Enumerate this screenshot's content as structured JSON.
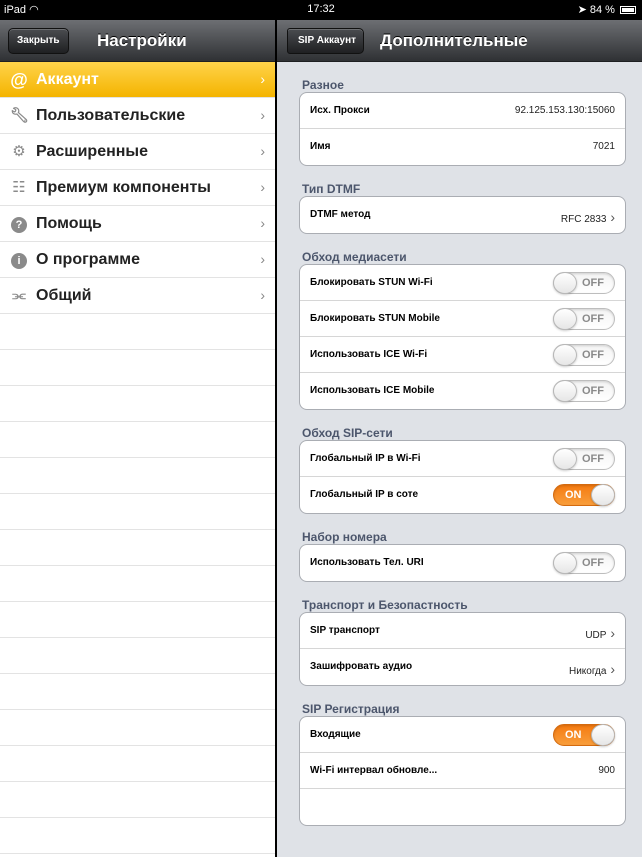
{
  "statusbar": {
    "device": "iPad",
    "time": "17:32",
    "battery": "84 %"
  },
  "left": {
    "close_label": "Закрыть",
    "title": "Настройки",
    "menu": [
      {
        "label": "Аккаунт",
        "icon": "at-icon",
        "active": true
      },
      {
        "label": "Пользовательские",
        "icon": "wrench-icon"
      },
      {
        "label": "Расширенные",
        "icon": "gears-icon"
      },
      {
        "label": "Премиум компоненты",
        "icon": "cart-icon"
      },
      {
        "label": "Помощь",
        "icon": "help-icon"
      },
      {
        "label": "О программе",
        "icon": "info-icon"
      },
      {
        "label": "Общий",
        "icon": "connector-icon"
      }
    ]
  },
  "right": {
    "back_label": "SIP Аккаунт",
    "title": "Дополнительные",
    "sections": {
      "misc": {
        "header": "Разное",
        "outbound_proxy": {
          "label": "Исх. Прокси",
          "value": "92.125.153.130:15060"
        },
        "name": {
          "label": "Имя",
          "value": "7021"
        }
      },
      "dtmf": {
        "header": "Тип DTMF",
        "method": {
          "label": "DTMF метод",
          "value": "RFC 2833"
        }
      },
      "media_nat": {
        "header": "Обход медиасети",
        "stun_wifi": {
          "label": "Блокировать STUN Wi-Fi",
          "state": "OFF"
        },
        "stun_mobile": {
          "label": "Блокировать STUN Mobile",
          "state": "OFF"
        },
        "ice_wifi": {
          "label": "Использовать ICE Wi-Fi",
          "state": "OFF"
        },
        "ice_mobile": {
          "label": "Использовать ICE Mobile",
          "state": "OFF"
        }
      },
      "sip_nat": {
        "header": "Обход SIP-сети",
        "global_ip_wifi": {
          "label": "Глобальный IP в Wi-Fi",
          "state": "OFF"
        },
        "global_ip_cell": {
          "label": "Глобальный IP в соте",
          "state": "ON"
        }
      },
      "dialing": {
        "header": "Набор номера",
        "tel_uri": {
          "label": "Использовать Тел. URI",
          "state": "OFF"
        }
      },
      "transport": {
        "header": "Транспорт и Безопастность",
        "sip_transport": {
          "label": "SIP транспорт",
          "value": "UDP"
        },
        "encrypt_audio": {
          "label": "Зашифровать аудио",
          "value": "Никогда"
        }
      },
      "registration": {
        "header": "SIP Регистрация",
        "incoming": {
          "label": "Входящие",
          "state": "ON"
        },
        "wifi_refresh": {
          "label": "Wi-Fi интервал обновле...",
          "value": "900"
        }
      }
    }
  },
  "colors": {
    "active_item": "#f4b400",
    "toggle_on": "#f57a10",
    "nav_bar": "#3a3c40"
  }
}
